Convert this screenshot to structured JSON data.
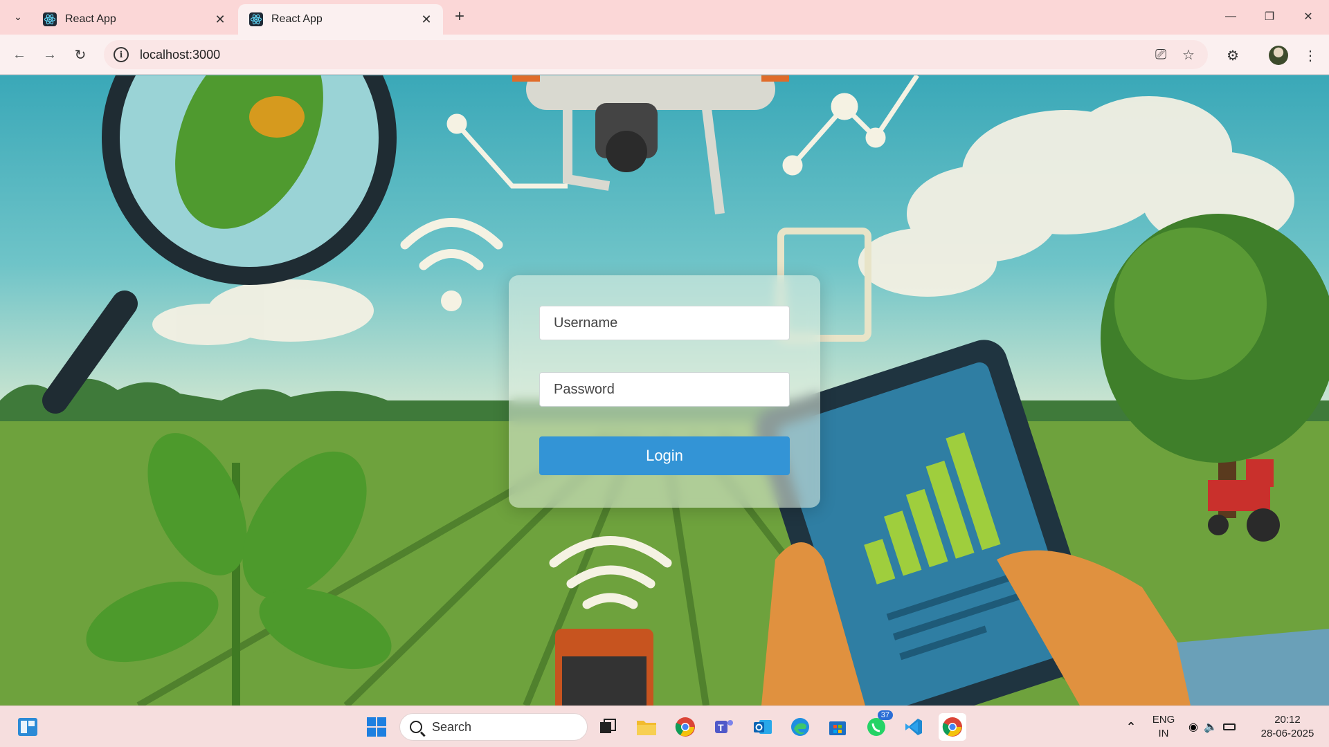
{
  "browser": {
    "tabs": [
      {
        "title": "React App",
        "active": false
      },
      {
        "title": "React App",
        "active": true
      }
    ],
    "url": "localhost:3000"
  },
  "login": {
    "username_placeholder": "Username",
    "password_placeholder": "Password",
    "button_label": "Login"
  },
  "taskbar": {
    "search_label": "Search",
    "whatsapp_badge": "37",
    "language_line1": "ENG",
    "language_line2": "IN",
    "time": "20:12",
    "date": "28-06-2025"
  },
  "icons": [
    "react-icon",
    "search-icon",
    "windows-icon",
    "file-explorer-icon",
    "chrome-icon",
    "teams-icon",
    "outlook-icon",
    "edge-icon",
    "store-icon",
    "whatsapp-icon",
    "vscode-icon",
    "wifi-icon",
    "volume-icon",
    "battery-icon"
  ]
}
